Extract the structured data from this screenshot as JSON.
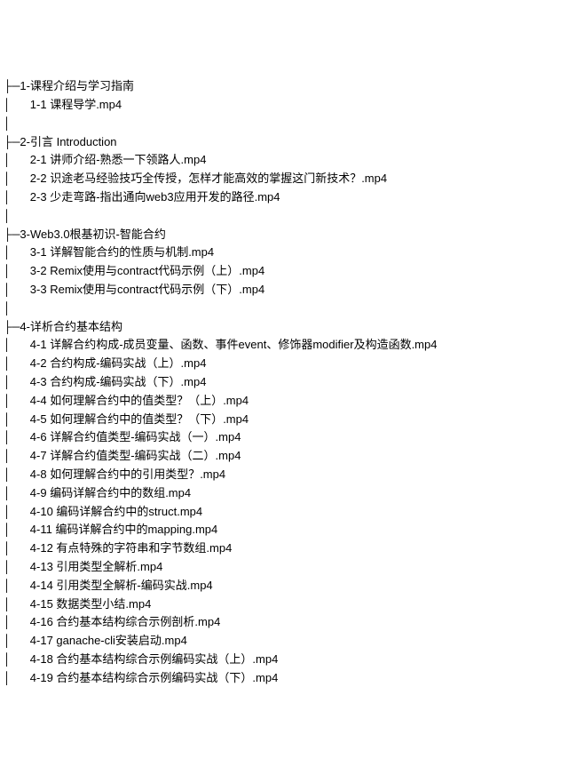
{
  "tree": [
    {
      "prefix": "├─",
      "text": "1-课程介绍与学习指南"
    },
    {
      "prefix": "│      ",
      "text": "1-1 课程导学.mp4"
    },
    {
      "prefix": "│",
      "text": ""
    },
    {
      "prefix": "├─",
      "text": "2-引言 Introduction"
    },
    {
      "prefix": "│      ",
      "text": "2-1 讲师介绍-熟悉一下领路人.mp4"
    },
    {
      "prefix": "│      ",
      "text": "2-2 识途老马经验技巧全传授，怎样才能高效的掌握这门新技术？.mp4"
    },
    {
      "prefix": "│      ",
      "text": "2-3 少走弯路-指出通向web3应用开发的路径.mp4"
    },
    {
      "prefix": "│",
      "text": ""
    },
    {
      "prefix": "├─",
      "text": "3-Web3.0根基初识-智能合约"
    },
    {
      "prefix": "│      ",
      "text": "3-1 详解智能合约的性质与机制.mp4"
    },
    {
      "prefix": "│      ",
      "text": "3-2 Remix使用与contract代码示例（上）.mp4"
    },
    {
      "prefix": "│      ",
      "text": "3-3 Remix使用与contract代码示例（下）.mp4"
    },
    {
      "prefix": "│",
      "text": ""
    },
    {
      "prefix": "├─",
      "text": "4-详析合约基本结构"
    },
    {
      "prefix": "│      ",
      "text": "4-1 详解合约构成-成员变量、函数、事件event、修饰器modifier及构造函数.mp4"
    },
    {
      "prefix": "│      ",
      "text": "4-2 合约构成-编码实战（上）.mp4"
    },
    {
      "prefix": "│      ",
      "text": "4-3 合约构成-编码实战（下）.mp4"
    },
    {
      "prefix": "│      ",
      "text": "4-4 如何理解合约中的值类型？（上）.mp4"
    },
    {
      "prefix": "│      ",
      "text": "4-5 如何理解合约中的值类型？（下）.mp4"
    },
    {
      "prefix": "│      ",
      "text": "4-6 详解合约值类型-编码实战（一）.mp4"
    },
    {
      "prefix": "│      ",
      "text": "4-7 详解合约值类型-编码实战（二）.mp4"
    },
    {
      "prefix": "│      ",
      "text": "4-8 如何理解合约中的引用类型？.mp4"
    },
    {
      "prefix": "│      ",
      "text": "4-9 编码详解合约中的数组.mp4"
    },
    {
      "prefix": "│      ",
      "text": "4-10 编码详解合约中的struct.mp4"
    },
    {
      "prefix": "│      ",
      "text": "4-11 编码详解合约中的mapping.mp4"
    },
    {
      "prefix": "│      ",
      "text": "4-12 有点特殊的字符串和字节数组.mp4"
    },
    {
      "prefix": "│      ",
      "text": "4-13 引用类型全解析.mp4"
    },
    {
      "prefix": "│      ",
      "text": "4-14 引用类型全解析-编码实战.mp4"
    },
    {
      "prefix": "│      ",
      "text": "4-15 数据类型小结.mp4"
    },
    {
      "prefix": "│      ",
      "text": "4-16 合约基本结构综合示例剖析.mp4"
    },
    {
      "prefix": "│      ",
      "text": "4-17 ganache-cli安装启动.mp4"
    },
    {
      "prefix": "│      ",
      "text": "4-18 合约基本结构综合示例编码实战（上）.mp4"
    },
    {
      "prefix": "│      ",
      "text": "4-19 合约基本结构综合示例编码实战（下）.mp4"
    }
  ]
}
